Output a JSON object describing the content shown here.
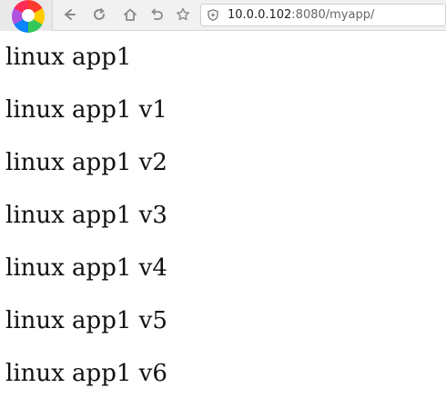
{
  "toolbar": {
    "icons": {
      "logo": "browser-logo-icon",
      "back": "back-arrow-icon",
      "reload": "reload-icon",
      "home": "home-icon",
      "history": "undo-history-icon",
      "favorite": "star-icon",
      "security": "shield-icon"
    },
    "url_host": "10.0.0.102",
    "url_rest": ":8080/myapp/"
  },
  "content": {
    "lines": [
      "linux app1",
      "linux app1 v1",
      "linux app1 v2",
      "linux app1 v3",
      "linux app1 v4",
      "linux app1 v5",
      "linux app1 v6"
    ]
  }
}
